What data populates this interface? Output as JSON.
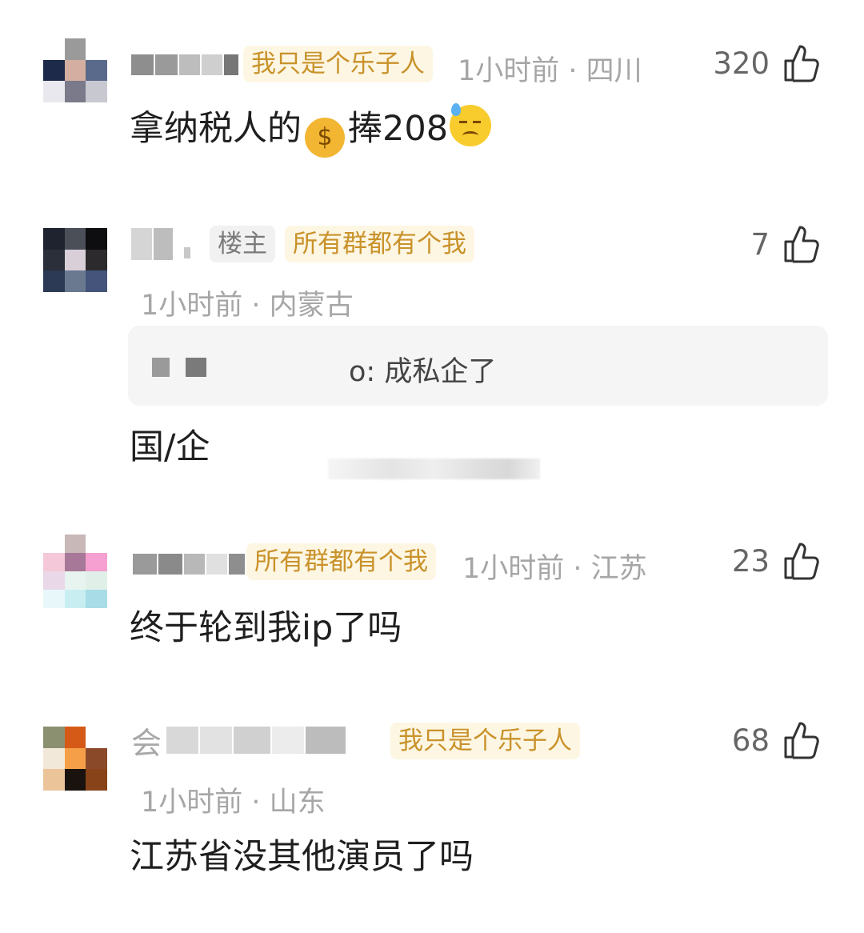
{
  "comments": [
    {
      "badge": "我只是个乐子人",
      "meta": "1小时前 · 四川",
      "likes": "320",
      "text_before": "拿纳税人的",
      "emoji_1": "💰",
      "text_after": "捧208",
      "emoji_2": "😓"
    },
    {
      "op_label": "楼主",
      "badge": "所有群都有个我",
      "meta": "1小时前 · 内蒙古",
      "likes": "7",
      "quote": "o: 成私企了",
      "text": "国/企"
    },
    {
      "badge": "所有群都有个我",
      "meta": "1小时前 · 江苏",
      "likes": "23",
      "text": "终于轮到我ip了吗"
    },
    {
      "name_prefix": "会",
      "badge": "我只是个乐子人",
      "meta": "1小时前 · 山东",
      "likes": "68",
      "text": "江苏省没其他演员了吗"
    }
  ],
  "icons": {
    "like": "thumbs-up-icon"
  },
  "colors": {
    "badge_bg": "#fdf6e3",
    "badge_text": "#c9922a",
    "meta": "#a6a6a6"
  }
}
